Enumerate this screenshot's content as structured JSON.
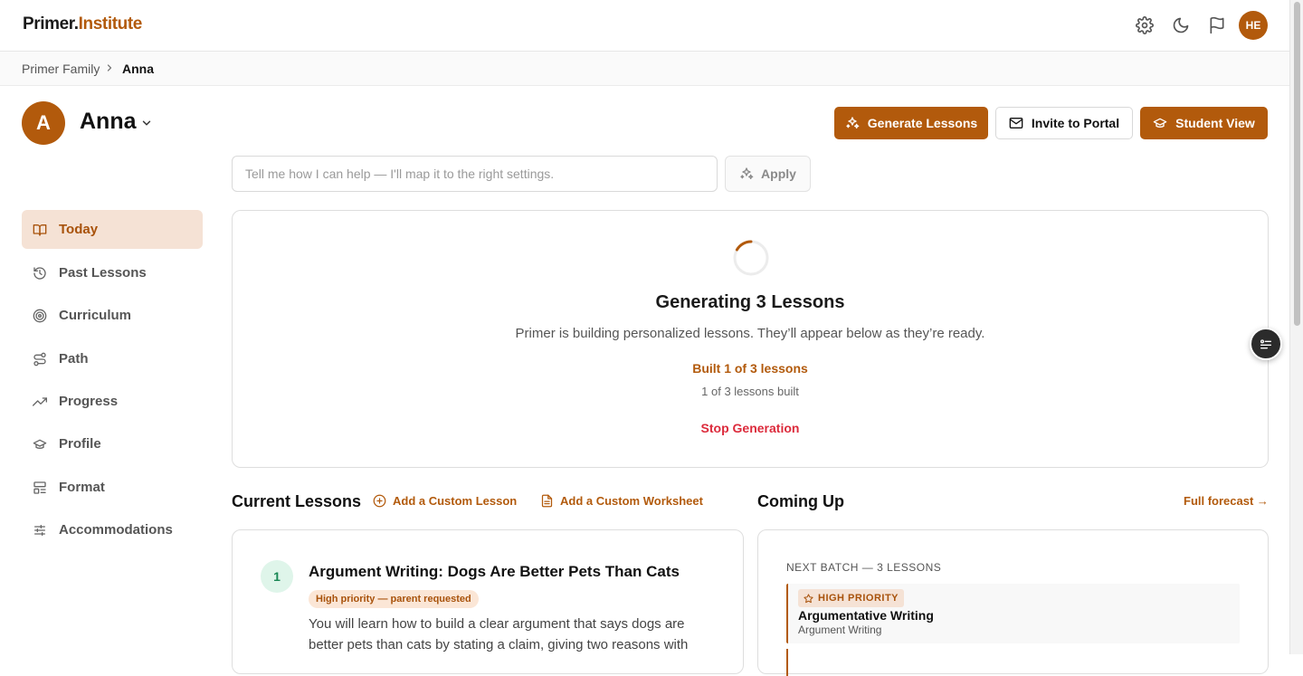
{
  "app": {
    "logo_part1": "Primer.",
    "logo_part2": "Institute",
    "brand_color": "#b25a0c"
  },
  "topbar": {
    "icons": [
      "gear-icon",
      "moon-icon",
      "flag-icon"
    ],
    "user_initials": "HE"
  },
  "breadcrumb": {
    "parent": "Primer Family",
    "current": "Anna"
  },
  "student": {
    "initial": "A",
    "name": "Anna"
  },
  "actions": {
    "generate": "Generate Lessons",
    "invite": "Invite to Portal",
    "student_view": "Student View"
  },
  "help": {
    "placeholder": "Tell me how I can help — I'll map it to the right settings.",
    "apply": "Apply"
  },
  "sidebar": {
    "items": [
      {
        "label": "Today",
        "icon": "book-open-icon",
        "active": true
      },
      {
        "label": "Past Lessons",
        "icon": "history-icon"
      },
      {
        "label": "Curriculum",
        "icon": "target-icon"
      },
      {
        "label": "Path",
        "icon": "route-icon"
      },
      {
        "label": "Progress",
        "icon": "trending-up-icon"
      },
      {
        "label": "Profile",
        "icon": "graduation-cap-icon"
      },
      {
        "label": "Format",
        "icon": "layout-icon"
      },
      {
        "label": "Accommodations",
        "icon": "sliders-icon"
      }
    ]
  },
  "generating": {
    "title": "Generating 3 Lessons",
    "description": "Primer is building personalized lessons. They’ll appear below as they’re ready.",
    "built": "Built 1 of 3 lessons",
    "sub": "1 of 3 lessons built",
    "stop": "Stop Generation"
  },
  "current_lessons": {
    "title": "Current Lessons",
    "add_lesson": "Add a Custom Lesson",
    "add_worksheet": "Add a Custom Worksheet",
    "lessons": [
      {
        "number": "1",
        "title": "Argument Writing: Dogs Are Better Pets Than Cats",
        "badge": "High priority — parent requested",
        "description": "You will learn how to build a clear argument that says dogs are better pets than cats by stating a claim, giving two reasons with"
      }
    ]
  },
  "coming_up": {
    "title": "Coming Up",
    "link": "Full forecast →",
    "batch_label": "NEXT BATCH — 3 LESSONS",
    "items": [
      {
        "priority": "HIGH PRIORITY",
        "title": "Argumentative Writing",
        "subtitle": "Argument Writing"
      }
    ]
  }
}
